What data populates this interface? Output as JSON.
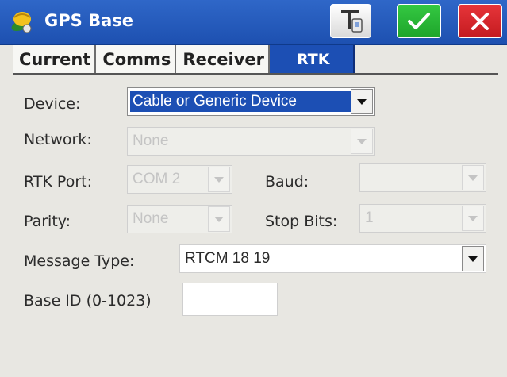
{
  "window": {
    "title": "GPS Base",
    "icons": {
      "app": "satellite-icon",
      "tools": "tools-icon",
      "ok": "checkmark-icon",
      "close": "close-x-icon"
    },
    "colors": {
      "titlebar": "#2f67c8",
      "ok": "#34c842",
      "close": "#e6353a",
      "active_tab": "#1c4fb4"
    }
  },
  "tabs": [
    {
      "label": "Current",
      "active": false
    },
    {
      "label": "Comms",
      "active": false
    },
    {
      "label": "Receiver",
      "active": false
    },
    {
      "label": "RTK",
      "active": true
    }
  ],
  "form": {
    "device": {
      "label": "Device:",
      "value": "Cable or Generic Device"
    },
    "network": {
      "label": "Network:",
      "value": "None"
    },
    "rtk_port": {
      "label": "RTK Port:",
      "value": "COM 2"
    },
    "baud": {
      "label": "Baud:",
      "value": ""
    },
    "parity": {
      "label": "Parity:",
      "value": "None"
    },
    "stop_bits": {
      "label": "Stop Bits:",
      "value": "1"
    },
    "message_type": {
      "label": "Message Type:",
      "value": "RTCM 18 19"
    },
    "base_id": {
      "label": "Base ID (0-1023)",
      "value": ""
    }
  }
}
